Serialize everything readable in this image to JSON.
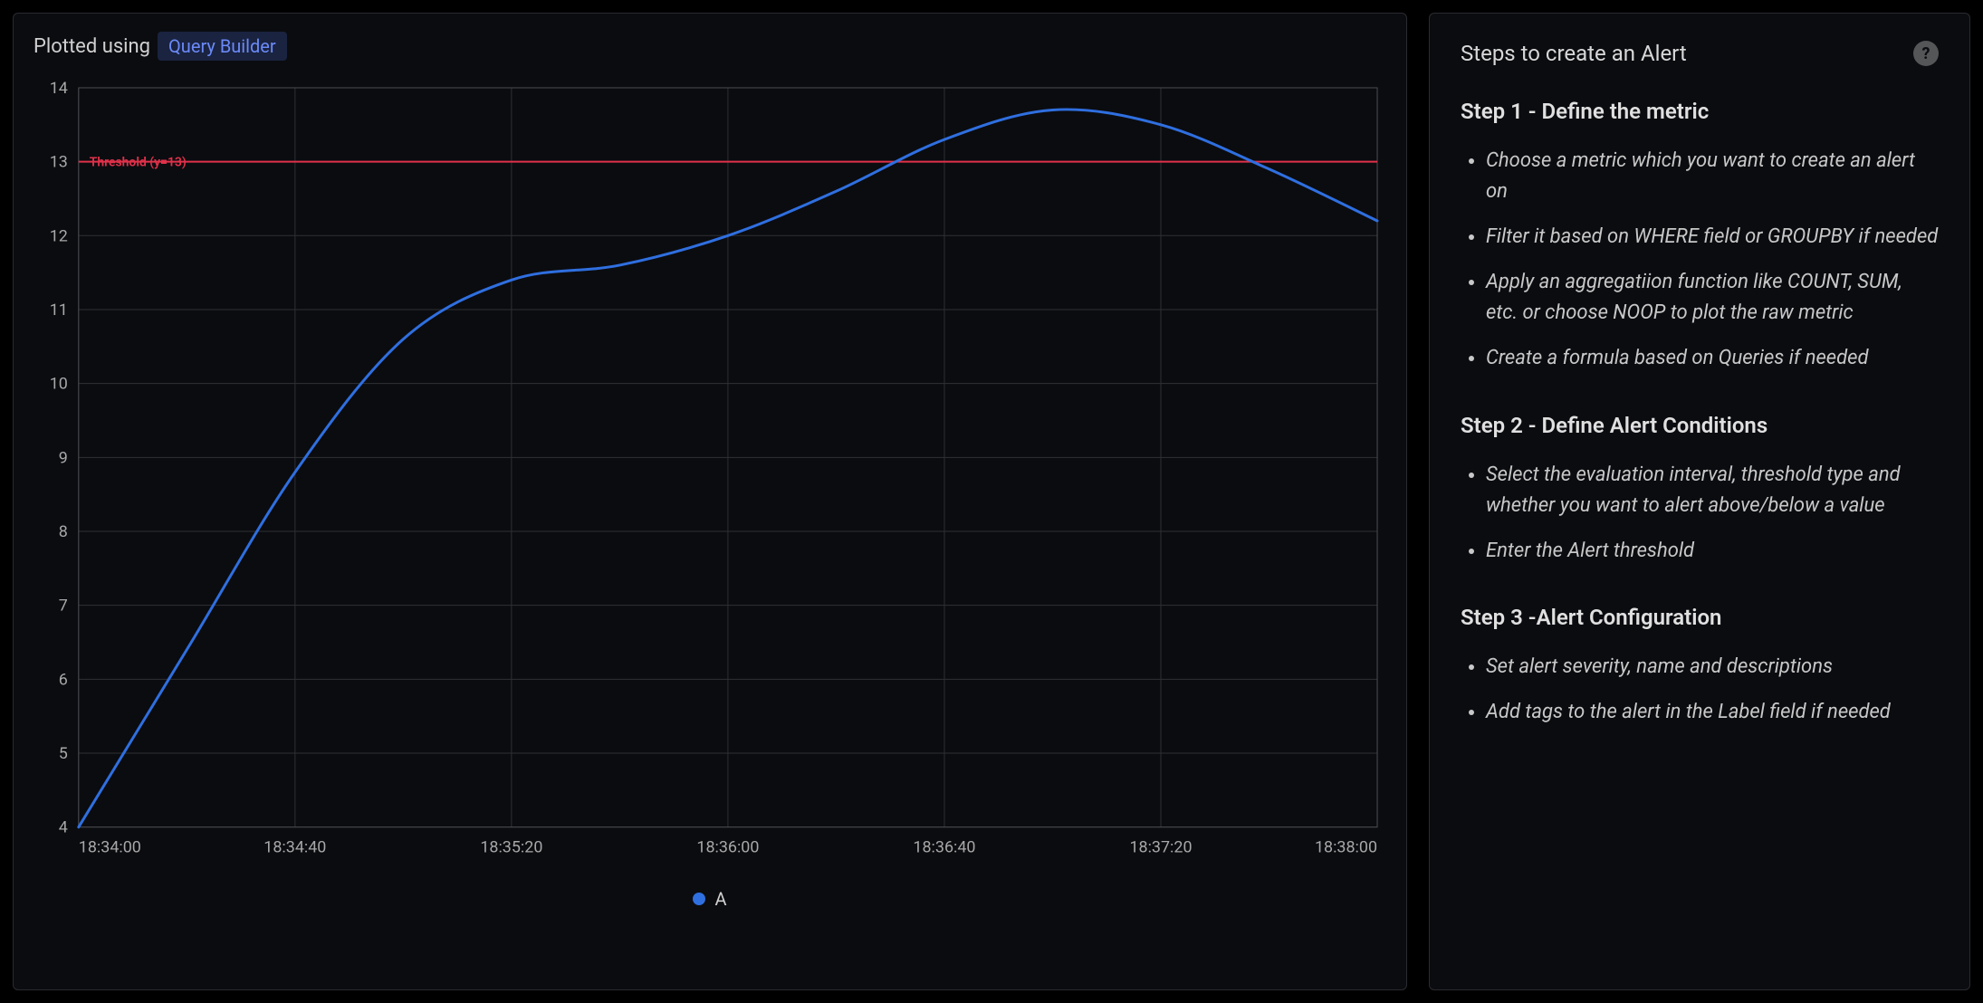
{
  "chart_panel": {
    "header_label": "Plotted using",
    "badge": "Query Builder",
    "legend_series": "A"
  },
  "side_panel": {
    "title": "Steps to create an Alert",
    "steps": [
      {
        "heading": "Step 1 - Define the metric",
        "items": [
          "Choose a metric which you want to create an alert on",
          "Filter it based on WHERE field or GROUPBY if needed",
          "Apply an aggregatiion function like COUNT, SUM, etc. or choose NOOP to plot the raw metric",
          "Create a formula based on Queries if needed"
        ]
      },
      {
        "heading": "Step 2 - Define Alert Conditions",
        "items": [
          "Select the evaluation interval, threshold type and whether you want to alert above/below a value",
          "Enter the Alert threshold"
        ]
      },
      {
        "heading": "Step 3 -Alert Configuration",
        "items": [
          "Set alert severity, name and descriptions",
          "Add tags to the alert in the Label field if needed"
        ]
      }
    ]
  },
  "chart_data": {
    "type": "line",
    "title": "",
    "xlabel": "",
    "ylabel": "",
    "ylim": [
      4,
      14
    ],
    "x_ticks": [
      "18:34:00",
      "18:34:40",
      "18:35:20",
      "18:36:00",
      "18:36:40",
      "18:37:20",
      "18:38:00"
    ],
    "y_ticks": [
      4,
      5,
      6,
      7,
      8,
      9,
      10,
      11,
      12,
      13,
      14
    ],
    "threshold": {
      "label": "Threshold (y=13)",
      "value": 13
    },
    "series": [
      {
        "name": "A",
        "color": "#2f6fe0",
        "x": [
          "18:34:00",
          "18:34:20",
          "18:34:40",
          "18:35:00",
          "18:35:20",
          "18:35:40",
          "18:36:00",
          "18:36:20",
          "18:36:40",
          "18:37:00",
          "18:37:20",
          "18:37:40",
          "18:38:00"
        ],
        "values": [
          4.0,
          6.4,
          8.8,
          10.6,
          11.4,
          11.6,
          12.0,
          12.6,
          13.3,
          13.7,
          13.5,
          12.9,
          12.2
        ]
      }
    ]
  }
}
